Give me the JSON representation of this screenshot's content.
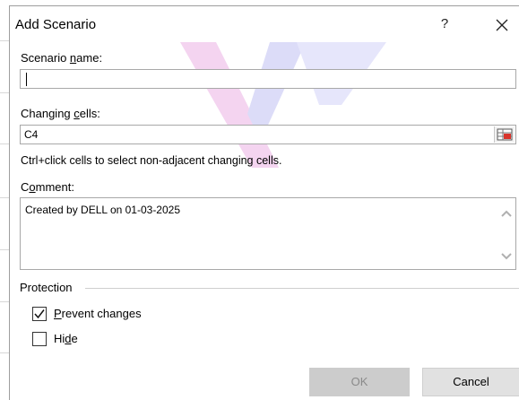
{
  "dialog": {
    "title": "Add Scenario",
    "help_label": "?",
    "scenario_name": {
      "label_pre": "Scenario ",
      "label_key": "n",
      "label_post": "ame:",
      "value": ""
    },
    "changing_cells": {
      "label_pre": "Changing ",
      "label_key": "c",
      "label_post": "ells:",
      "value": "C4"
    },
    "hint": "Ctrl+click cells to select non-adjacent changing cells.",
    "comment": {
      "label_pre": "C",
      "label_key": "o",
      "label_post": "mment:",
      "value": "Created by DELL on 01-03-2025"
    },
    "protection": {
      "title": "Protection",
      "prevent_changes": {
        "label_key": "P",
        "label_post": "revent changes",
        "checked": true
      },
      "hide": {
        "label_pre": "Hi",
        "label_key": "d",
        "label_post": "e",
        "checked": false
      }
    },
    "buttons": {
      "ok": "OK",
      "cancel": "Cancel"
    }
  },
  "colors": {
    "ok_disabled_bg": "#cccccc",
    "cancel_bg": "#e1e1e1",
    "border": "#a8a8a8"
  },
  "icons": {
    "close": "close-icon",
    "range_picker": "range-picker-icon",
    "checkmark": "checkmark-icon",
    "scroll_up": "chevron-up-icon",
    "scroll_down": "chevron-down-icon"
  }
}
